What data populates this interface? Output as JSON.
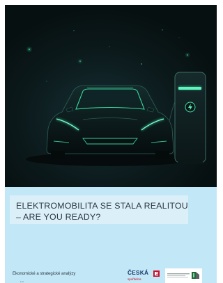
{
  "report": {
    "title_line1": "ELEKTROMOBILITA SE STALA REALITOU",
    "title_line2": "– ARE YOU READY?",
    "series_caption": "Ekonomické a strategické analýzy",
    "footer_marker": "• •"
  },
  "branding": {
    "csas_name": "ČESKÁ",
    "csas_subline": "spořitelna",
    "partner_icon": "partner-logo-icon"
  },
  "hero": {
    "illustration": "electric-car-charging",
    "glow_color": "#3de0a4",
    "background_color": "#0a1112"
  },
  "colors": {
    "lower_band": "#c2e7f6",
    "title_box": "#dbeff8",
    "title_text": "#2b3842",
    "csas_blue": "#1a3a6e",
    "csas_red": "#c8102e"
  }
}
